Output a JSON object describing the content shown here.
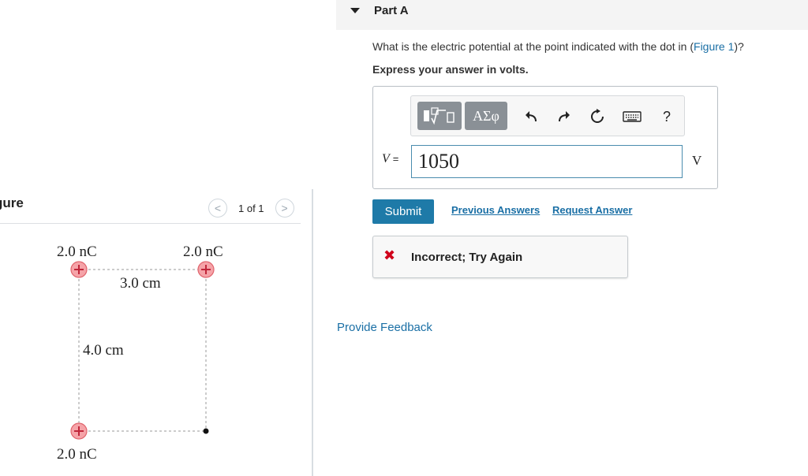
{
  "figure_panel": {
    "title": "gure",
    "pager_text": "1 of 1",
    "prev_glyph": "<",
    "next_glyph": ">",
    "charges": {
      "top_left_label": "2.0 nC",
      "top_right_label": "2.0 nC",
      "bottom_left_label": "2.0 nC",
      "plus_glyph": "+"
    },
    "dimensions": {
      "horizontal": "3.0 cm",
      "vertical": "4.0 cm"
    },
    "colors": {
      "charge_fill": "#f5a3a8",
      "charge_stroke": "#e0646d",
      "dashed_line": "#9a9a9a"
    }
  },
  "part": {
    "title": "Part A",
    "question_prefix": "What is the electric potential at the point indicated with the dot in (",
    "figure_link": "Figure 1",
    "question_suffix": ")?",
    "instruction": "Express your answer in volts."
  },
  "toolbar": {
    "greek_label": "ΑΣφ",
    "help_label": "?",
    "icons": [
      "template-icon",
      "undo-icon",
      "redo-icon",
      "reset-icon",
      "keyboard-icon",
      "help-icon"
    ]
  },
  "answer": {
    "variable": "V",
    "equals": "=",
    "value": "1050",
    "unit": "V"
  },
  "actions": {
    "submit_label": "Submit",
    "previous_answers_label": "Previous Answers",
    "request_answer_label": "Request Answer"
  },
  "feedback": {
    "status_glyph": "✖",
    "message": "Incorrect; Try Again",
    "provide_feedback_label": "Provide Feedback"
  },
  "colors": {
    "accent": "#1e7aa8",
    "link": "#1a6fa5",
    "error": "#d0021b"
  }
}
